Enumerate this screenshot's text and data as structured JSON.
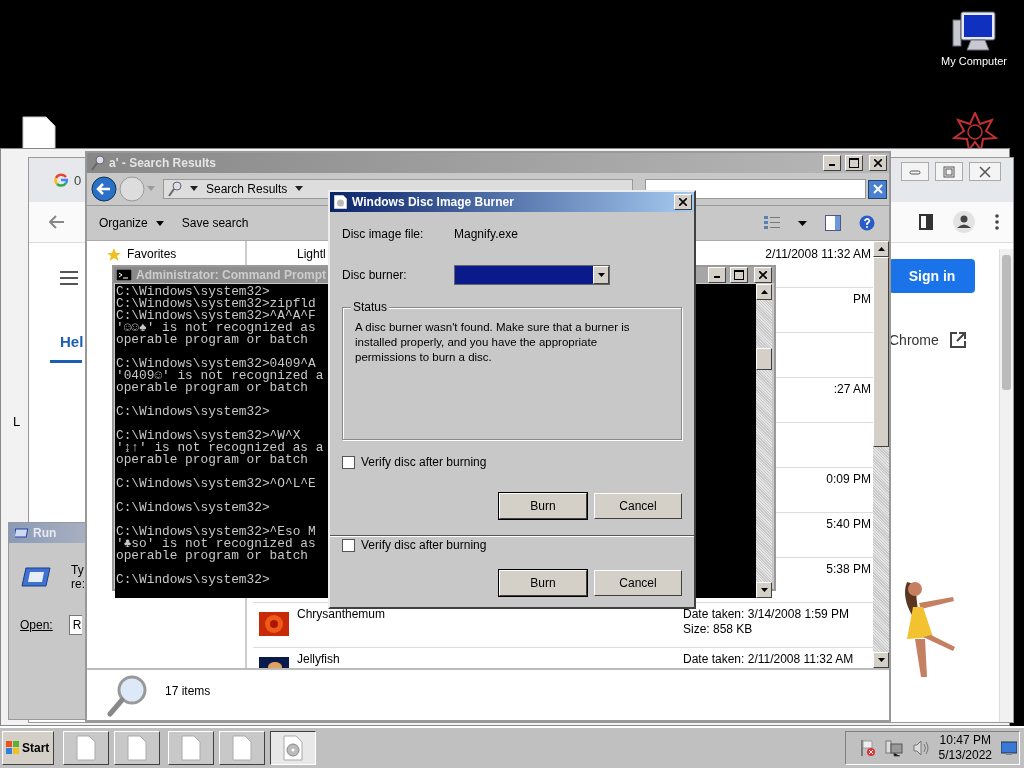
{
  "desktop": {
    "icons": [
      {
        "label": "My Computer"
      }
    ]
  },
  "back_window": {
    "side_letter": "L"
  },
  "browser": {
    "tab_text": "0",
    "help_link": "Hel",
    "sign_in": "Sign in",
    "link_text": "Chrome"
  },
  "run_dialog": {
    "title": "Run",
    "prompt": [
      "Ty",
      "re:"
    ],
    "open_label": "Open:",
    "value": "R"
  },
  "explorer": {
    "title": "a' - Search Results",
    "breadcrumb": "Search Results",
    "toolbar": [
      {
        "label": "Organize",
        "menu": true
      },
      {
        "label": "Save search",
        "menu": false
      }
    ],
    "nav_items": [
      "Favorites"
    ],
    "files": [
      {
        "kind": "partial",
        "name": "Lightl",
        "detail": [
          "2/11/2008 11:32 AM"
        ]
      },
      {
        "kind": "partial",
        "detail": [
          "PM"
        ]
      },
      {
        "kind": "covered"
      },
      {
        "kind": "partial",
        "detail": [
          ":27 AM"
        ]
      },
      {
        "kind": "covered"
      },
      {
        "kind": "partial",
        "detail": [
          "0:09 PM"
        ]
      },
      {
        "kind": "partial",
        "detail": [
          "5:40 PM"
        ]
      },
      {
        "kind": "partial",
        "detail": [
          "5:38 PM"
        ]
      },
      {
        "kind": "file",
        "name": "Chrysanthemum",
        "detail": [
          "Date taken: 3/14/2008 1:59 PM",
          "Size: 858 KB"
        ]
      },
      {
        "kind": "file",
        "name": "Jellyfish",
        "detail": [
          "Date taken: 2/11/2008 11:32 AM"
        ]
      }
    ],
    "status": "17 items"
  },
  "console": {
    "title": "Administrator: Command Prompt",
    "blocks": [
      [
        "C:\\Windows\\system32>",
        "C:\\Windows\\system32>zipfld",
        "C:\\Windows\\system32>^A^A^F",
        "'☺☺♠' is not recognized as",
        "operable program or batch"
      ],
      [
        "C:\\Windows\\system32>0409^A",
        "'0409☺' is not recognized a",
        "operable program or batch"
      ],
      [
        "C:\\Windows\\system32>"
      ],
      [
        "C:\\Windows\\system32>^W^X",
        "'↨↑' is not recognized as a",
        "operable program or batch"
      ],
      [
        "C:\\Windows\\system32>^O^L^E"
      ],
      [
        "C:\\Windows\\system32>"
      ],
      [
        "C:\\Windows\\system32>^Eso M",
        "'♣so' is not recognized as",
        "operable program or batch"
      ],
      [
        "C:\\Windows\\system32>"
      ]
    ]
  },
  "disc_dialog": {
    "title": "Windows Disc Image Burner",
    "image_label": "Disc image file:",
    "image_value": "Magnify.exe",
    "burner_label": "Disc burner:",
    "burner_highlighted": true,
    "status_title": "Status",
    "status_text": "A disc burner wasn't found. Make sure that a burner is installed properly, and you have the appropriate permissions to burn a disc.",
    "sections": [
      {
        "verify_label": "Verify disc after burning",
        "checked": false,
        "buttons": [
          "Burn",
          "Cancel"
        ]
      },
      {
        "verify_label": "Verify disc after burning",
        "checked": false,
        "buttons": [
          "Burn",
          "Cancel"
        ]
      }
    ]
  },
  "taskbar": {
    "start": "Start",
    "buttons": [
      {
        "kind": "document",
        "selected": false
      },
      {
        "kind": "document",
        "selected": false
      },
      {
        "kind": "document",
        "selected": false
      },
      {
        "kind": "document",
        "selected": false
      },
      {
        "kind": "disc",
        "selected": true
      }
    ],
    "time": "10:47 PM",
    "date": "5/13/2022"
  }
}
